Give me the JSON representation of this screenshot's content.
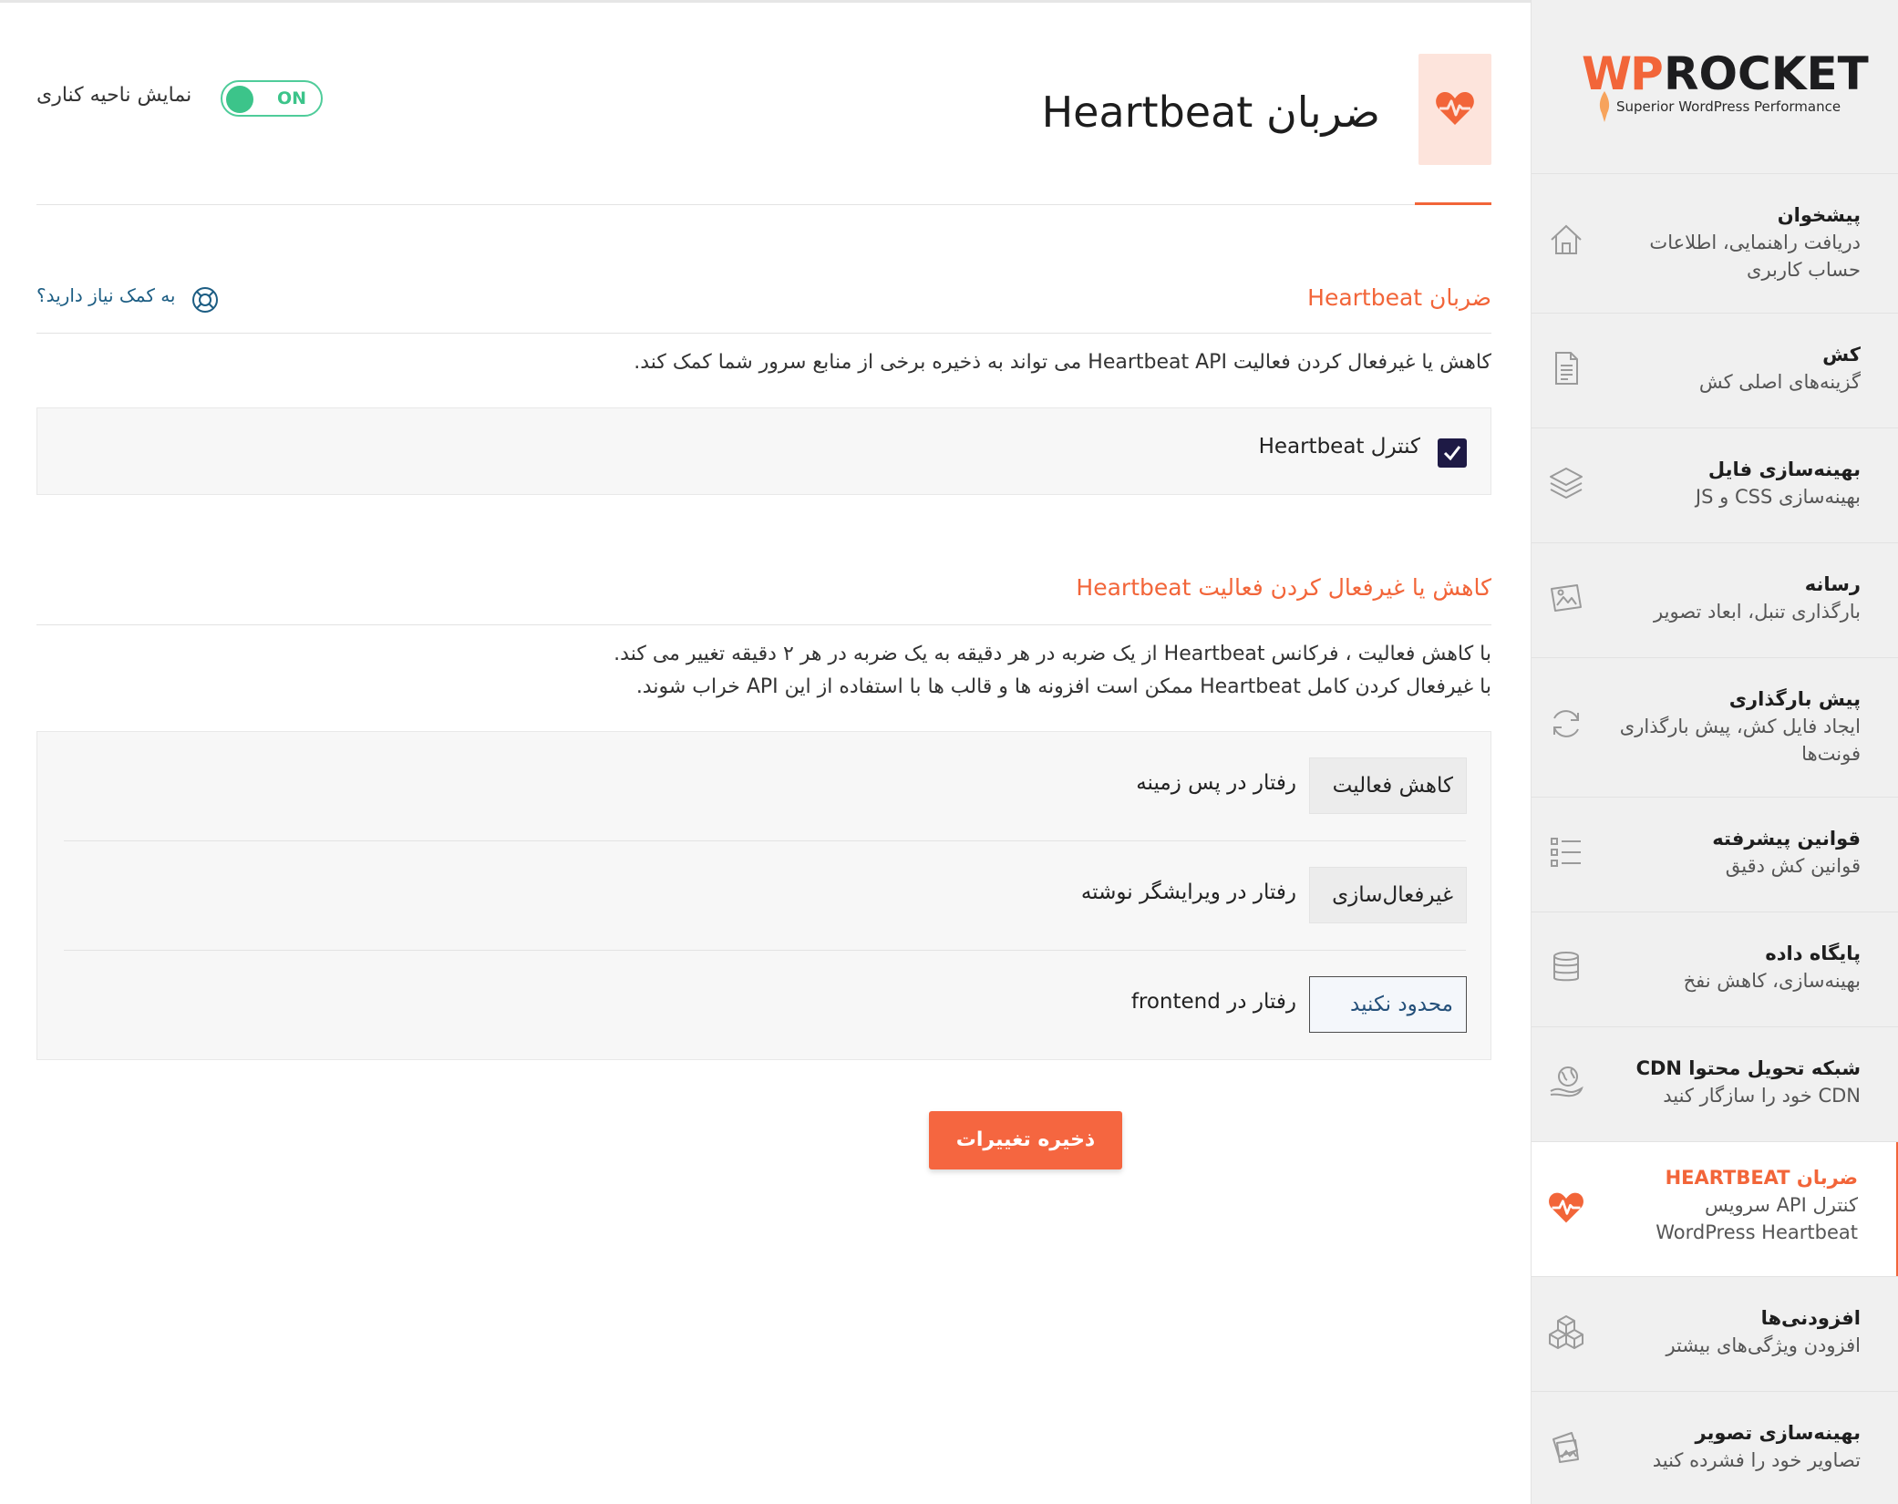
{
  "brand": {
    "logo_w": "WP",
    "logo_rocket": "ROCKET",
    "tagline": "Superior WordPress Performance",
    "accent": "#f26539",
    "toggle_color": "#3cc48a",
    "checkbox_color": "#1e1a45"
  },
  "sidebar": {
    "items": [
      {
        "title": "پیشخوان",
        "sub1": "دریافت راهنمایی، اطلاعات",
        "sub2": "حساب کاربری",
        "icon": "home-icon"
      },
      {
        "title": "کش",
        "sub1": "گزینه‌های اصلی کش",
        "sub2": "",
        "icon": "document-icon"
      },
      {
        "title": "بهینه‌سازی فایل",
        "sub1": "بهینه‌سازی CSS و JS",
        "sub2": "",
        "icon": "layers-icon"
      },
      {
        "title": "رسانه",
        "sub1": "بارگذاری تنبل، ابعاد تصویر",
        "sub2": "",
        "icon": "image-icon"
      },
      {
        "title": "پیش بارگذاری",
        "sub1": "ایجاد فایل کش، پیش بارگذاری",
        "sub2": "فونت‌ها",
        "icon": "refresh-icon"
      },
      {
        "title": "قوانین پیشرفته",
        "sub1": "قوانین کش دقیق",
        "sub2": "",
        "icon": "list-icon"
      },
      {
        "title": "پایگاه داده",
        "sub1": "بهینه‌سازی، کاهش نفخ",
        "sub2": "",
        "icon": "database-icon"
      },
      {
        "title": "شبکه تحویل محتوا CDN",
        "sub1": "CDN خود را سازگار کنید",
        "sub2": "",
        "icon": "globe-hand-icon"
      },
      {
        "title": "ضربان HEARTBEAT",
        "sub1": "کنترل API سرویس",
        "sub2": "WordPress Heartbeat",
        "icon": "heartbeat-icon"
      },
      {
        "title": "افزودنی‌ها",
        "sub1": "افزودن ویژگی‌های بیشتر",
        "sub2": "",
        "icon": "cubes-icon"
      },
      {
        "title": "بهینه‌سازی تصویر",
        "sub1": "تصاویر خود را فشرده کنید",
        "sub2": "",
        "icon": "photos-icon"
      }
    ]
  },
  "header": {
    "title": "ضربان Heartbeat",
    "sidebar_toggle_label": "نمایش ناحیه کناری",
    "toggle_state": "ON"
  },
  "section1": {
    "title": "ضربان Heartbeat",
    "help": "به کمک نیاز دارید؟",
    "description": "کاهش یا غیرفعال کردن فعالیت Heartbeat API می تواند به ذخیره برخی از منابع سرور شما کمک کند.",
    "checkbox_label": "کنترل Heartbeat",
    "checkbox_checked": true
  },
  "section2": {
    "title": "کاهش یا غیرفعال کردن فعالیت Heartbeat",
    "desc_line1": "با کاهش فعالیت ، فرکانس Heartbeat از یک ضربه در هر دقیقه به یک ضربه در هر ۲ دقیقه تغییر می کند.",
    "desc_line2": "با غیرفعال کردن کامل Heartbeat ممکن است افزونه ها و قالب ها با استفاده از این API خراب شوند.",
    "rows": [
      {
        "label": "رفتار در پس زمینه",
        "value": "کاهش فعالیت"
      },
      {
        "label": "رفتار در ویرایشگر نوشته",
        "value": "غیرفعال‌سازی"
      },
      {
        "label": "رفتار در frontend",
        "value": "محدود نکنید"
      }
    ]
  },
  "actions": {
    "save_label": "ذخیره تغییرات"
  }
}
